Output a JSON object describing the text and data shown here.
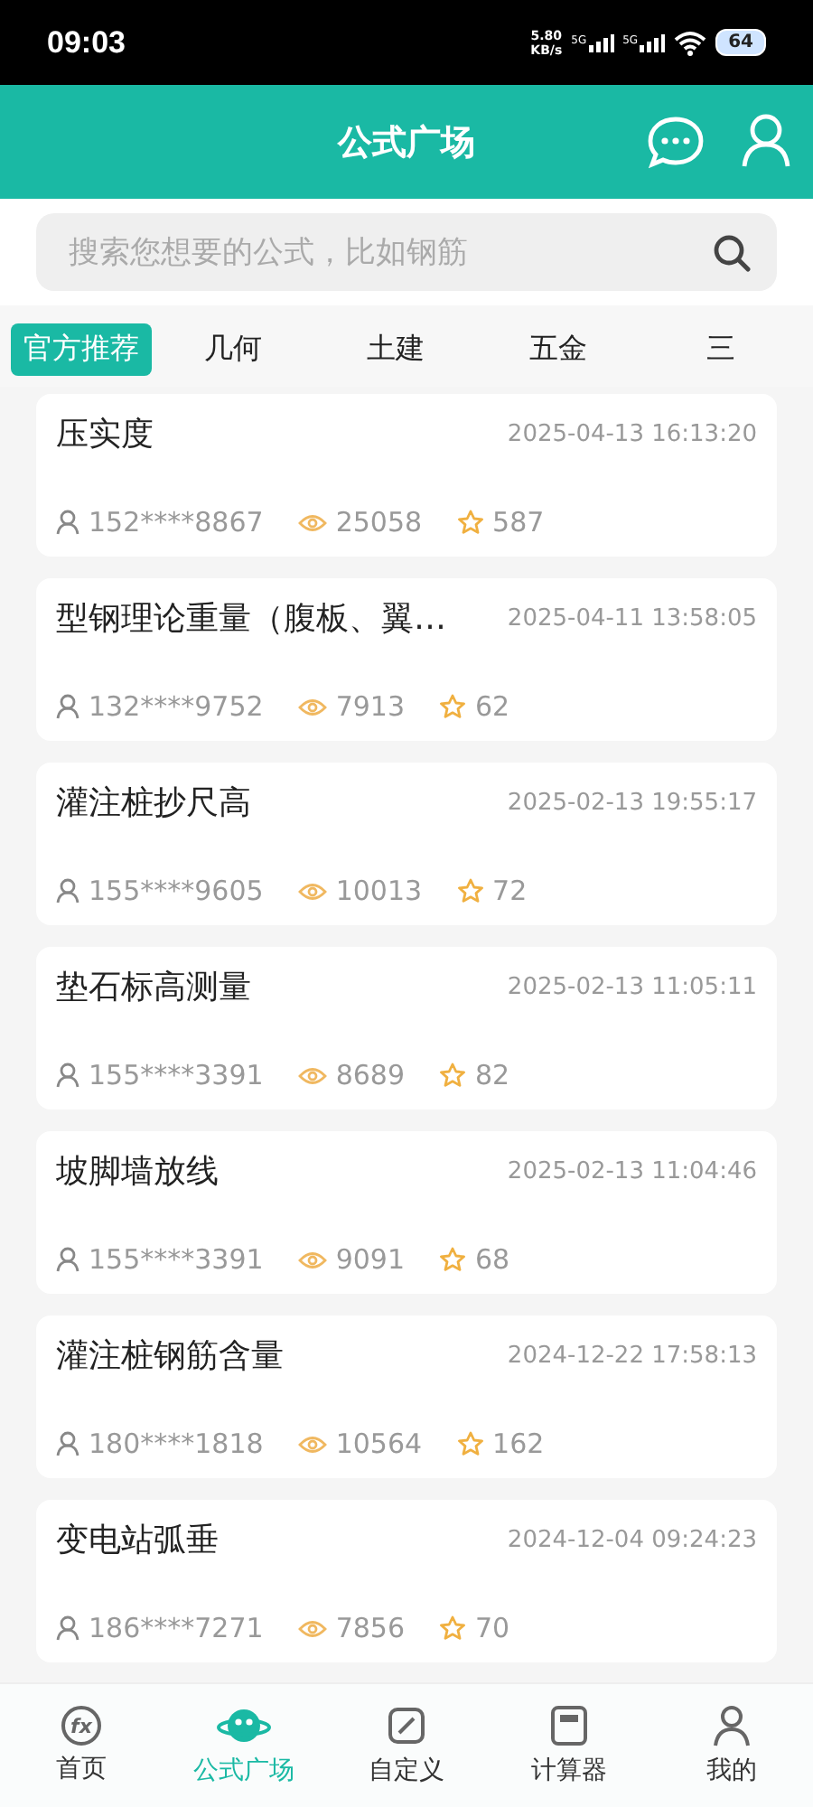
{
  "status_bar": {
    "time": "09:03",
    "speed_value": "5.80",
    "speed_unit": "KB/s",
    "sim_labels": [
      "5G",
      "5G"
    ],
    "battery": "64"
  },
  "header": {
    "title": "公式广场"
  },
  "search": {
    "placeholder": "搜索您想要的公式，比如钢筋"
  },
  "tabs": [
    {
      "label": "官方推荐",
      "selected": true
    },
    {
      "label": "几何",
      "selected": false
    },
    {
      "label": "土建",
      "selected": false
    },
    {
      "label": "五金",
      "selected": false
    },
    {
      "label": "三",
      "selected": false
    }
  ],
  "formulas": [
    {
      "title": "压实度",
      "date": "2025-04-13 16:13:20",
      "author": "152****8867",
      "views": "25058",
      "favorites": "587"
    },
    {
      "title": "型钢理论重量（腹板、翼…",
      "date": "2025-04-11 13:58:05",
      "author": "132****9752",
      "views": "7913",
      "favorites": "62"
    },
    {
      "title": "灌注桩抄尺高",
      "date": "2025-02-13 19:55:17",
      "author": "155****9605",
      "views": "10013",
      "favorites": "72"
    },
    {
      "title": "垫石标高测量",
      "date": "2025-02-13 11:05:11",
      "author": "155****3391",
      "views": "8689",
      "favorites": "82"
    },
    {
      "title": "坡脚墙放线",
      "date": "2025-02-13 11:04:46",
      "author": "155****3391",
      "views": "9091",
      "favorites": "68"
    },
    {
      "title": "灌注桩钢筋含量",
      "date": "2024-12-22 17:58:13",
      "author": "180****1818",
      "views": "10564",
      "favorites": "162"
    },
    {
      "title": "变电站弧垂",
      "date": "2024-12-04 09:24:23",
      "author": "186****7271",
      "views": "7856",
      "favorites": "70"
    }
  ],
  "bottom_nav": [
    {
      "label": "首页",
      "kind": "fx",
      "icon_text": "fx",
      "selected": false
    },
    {
      "label": "公式广场",
      "kind": "planet",
      "selected": true
    },
    {
      "label": "自定义",
      "kind": "edit",
      "selected": false
    },
    {
      "label": "计算器",
      "kind": "calc",
      "selected": false
    },
    {
      "label": "我的",
      "kind": "user",
      "selected": false
    }
  ]
}
